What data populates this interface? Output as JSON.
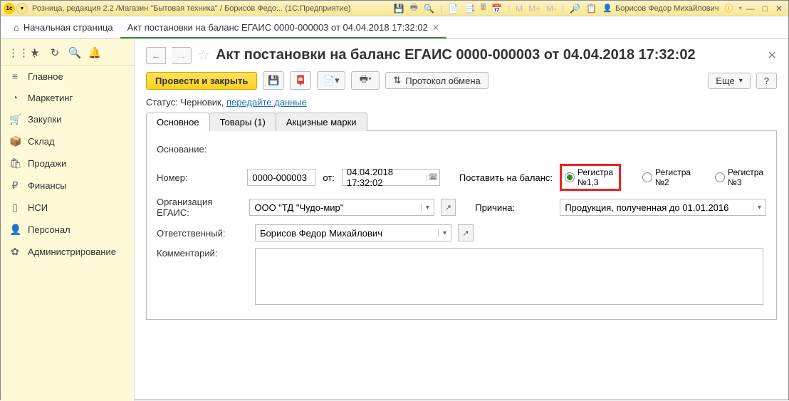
{
  "titlebar": {
    "app_title": "Розница, редакция 2.2 /Магазин \"Бытовая техника\" / Борисов Федо... (1С:Предприятие)",
    "user_label": "Борисов Федор Михайлович",
    "m_labels": [
      "M",
      "M+",
      "M-"
    ]
  },
  "tabs_top": {
    "home": "Начальная страница",
    "doc": "Акт постановки на баланс ЕГАИС 0000-000003 от 04.04.2018 17:32:02"
  },
  "sidebar": {
    "items": [
      {
        "icon": "≡",
        "label": "Главное"
      },
      {
        "icon": "◔",
        "label": "Маркетинг"
      },
      {
        "icon": "🛒",
        "label": "Закупки"
      },
      {
        "icon": "📦",
        "label": "Склад"
      },
      {
        "icon": "🛍",
        "label": "Продажи"
      },
      {
        "icon": "₽",
        "label": "Финансы"
      },
      {
        "icon": "▯",
        "label": "НСИ"
      },
      {
        "icon": "👤",
        "label": "Персонал"
      },
      {
        "icon": "✿",
        "label": "Администрирование"
      }
    ]
  },
  "page": {
    "title": "Акт постановки на баланс ЕГАИС 0000-000003 от 04.04.2018 17:32:02",
    "btn_post_close": "Провести и закрыть",
    "btn_protocol": "Протокол обмена",
    "btn_more": "Еще",
    "btn_help": "?",
    "status_prefix": "Статус: ",
    "status_value": "Черновик, ",
    "status_link": "передайте данные"
  },
  "form_tabs": {
    "t1": "Основное",
    "t2": "Товары (1)",
    "t3": "Акцизные марки"
  },
  "form": {
    "basis_label": "Основание:",
    "number_label": "Номер:",
    "number_value": "0000-000003",
    "from_label": "от:",
    "date_value": "04.04.2018 17:32:02",
    "register_label": "Поставить на баланс:",
    "org_label": "Организация ЕГАИС:",
    "org_value": "ООО \"ТД \"Чудо-мир\"",
    "reason_label": "Причина:",
    "reason_value": "Продукция, полученная до 01.01.2016",
    "resp_label": "Ответственный:",
    "resp_value": "Борисов Федор Михайлович",
    "comment_label": "Комментарий:",
    "radio1": "Регистра №1,3",
    "radio2": "Регистра №2",
    "radio3": "Регистра №3"
  }
}
